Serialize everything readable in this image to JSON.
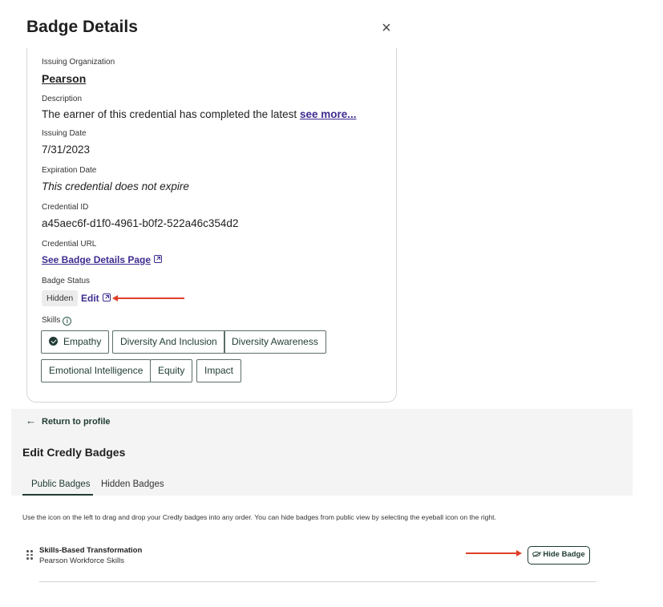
{
  "panel": {
    "title": "Badge Details",
    "close_icon": "×"
  },
  "details": {
    "issuing_org_label": "Issuing Organization",
    "issuing_org_value": "Pearson",
    "description_label": "Description",
    "description_text": "The earner of this credential has completed the latest",
    "description_more": "see more...",
    "issuing_date_label": "Issuing Date",
    "issuing_date_value": "7/31/2023",
    "expiration_label": "Expiration Date",
    "expiration_value": "This credential does not expire",
    "credential_id_label": "Credential ID",
    "credential_id_value": "a45aec6f-d1f0-4961-b0f2-522a46c354d2",
    "credential_url_label": "Credential URL",
    "credential_url_link": "See Badge Details Page",
    "badge_status_label": "Badge Status",
    "badge_status_value": "Hidden",
    "badge_status_edit": "Edit",
    "skills_label": "Skills",
    "skills": [
      "Empathy",
      "Diversity And Inclusion",
      "Diversity Awareness",
      "Emotional Intelligence",
      "Equity",
      "Impact"
    ]
  },
  "profile": {
    "return_label": "Return to profile",
    "section_title": "Edit Credly Badges",
    "tabs": [
      "Public Badges",
      "Hidden Badges"
    ],
    "active_tab": "Public Badges",
    "help_text": "Use the icon on the left to drag and drop your Credly badges into any order. You can hide badges from public view by selecting the eyeball icon on the right.",
    "badges": [
      {
        "name": "Skills-Based Transformation",
        "issuer": "Pearson Workforce Skills",
        "action": "Hide Badge"
      }
    ]
  },
  "colors": {
    "accent_purple": "#3e2b8f",
    "accent_green": "#1f3b34",
    "annotation_red": "#e0402a"
  }
}
